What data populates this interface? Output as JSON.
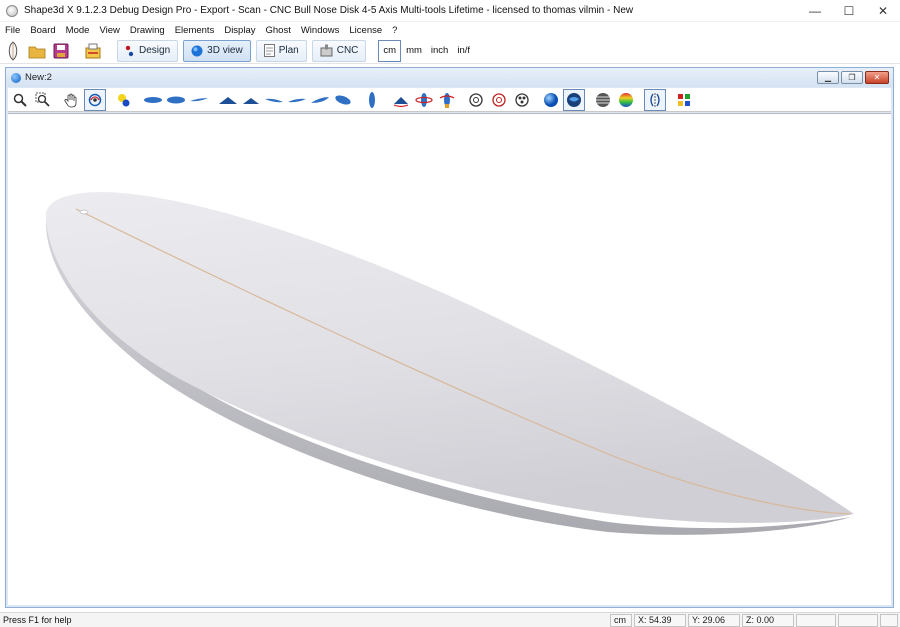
{
  "window": {
    "title": "Shape3d X 9.1.2.3 Debug Design Pro - Export - Scan - CNC Bull Nose Disk 4-5 Axis Multi-tools Lifetime - licensed to thomas vilmin - New",
    "minimize": "—",
    "maximize": "☐",
    "close": "✕"
  },
  "menu": [
    "File",
    "Board",
    "Mode",
    "View",
    "Drawing",
    "Elements",
    "Display",
    "Ghost",
    "Windows",
    "License",
    "?"
  ],
  "toolbar": {
    "modes": [
      "Design",
      "3D view",
      "Plan",
      "CNC"
    ],
    "active_mode": "3D view",
    "units": [
      "cm",
      "mm",
      "inch",
      "in/f"
    ],
    "active_unit": "cm"
  },
  "document": {
    "name": "New:2",
    "ctrl_minimize": "▁",
    "ctrl_restore": "❐",
    "ctrl_close": "✕"
  },
  "status": {
    "help": "Press F1 for help",
    "unit": "cm",
    "x": "X: 54.39",
    "y": "Y: 29.06",
    "z": "Z: 0.00"
  },
  "colors": {
    "board": "#dedee2",
    "stringer": "#d8b89a",
    "accent": "#2f6fc4"
  }
}
